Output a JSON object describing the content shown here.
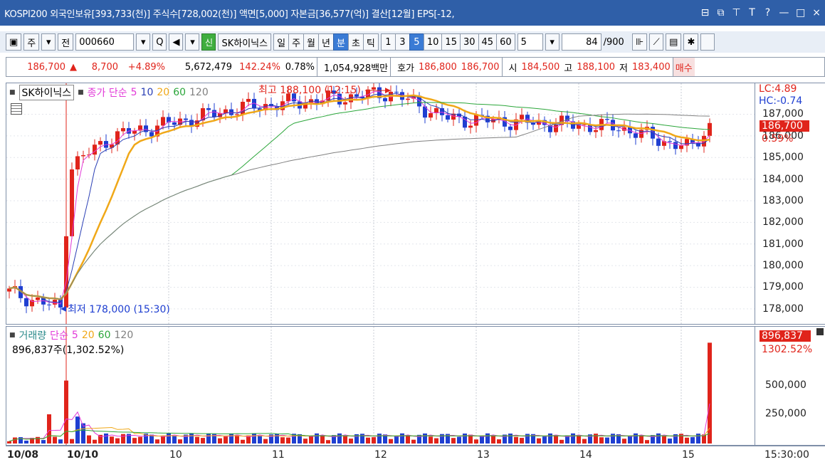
{
  "title": {
    "text": "KOSPI200 외국인보유[393,733(천)] 주식수[728,002(천)] 액면[5,000] 자본금[36,577(억)] 결산[12월] EPS[-12,",
    "icons": [
      "window-restore-icon",
      "popout-icon",
      "pin-icon",
      "font-icon",
      "help-icon",
      "minimize-icon",
      "maximize-icon",
      "close-icon"
    ],
    "icon_glyphs": [
      "⊟",
      "⧉",
      "⊤",
      "T",
      "?",
      "—",
      "□",
      "×"
    ]
  },
  "toolbar": {
    "menu_label": "주",
    "market_label": "전",
    "code": "000660",
    "search_glyph": "Q",
    "sound_glyph": "◀",
    "new_label": "신",
    "stock_name": "SK하이닉스",
    "period_buttons": [
      "일",
      "주",
      "월",
      "년"
    ],
    "active_period": "분",
    "sub_buttons": [
      "분",
      "초",
      "틱"
    ],
    "interval_buttons": [
      "1",
      "3",
      "5",
      "10",
      "15",
      "30",
      "45",
      "60"
    ],
    "active_interval": "5",
    "interval_value": "5",
    "count_value": "84",
    "count_total": "/900"
  },
  "quote": {
    "price": "186,700",
    "arrow": "▲",
    "change": "8,700",
    "change_pct": "+4.89%",
    "volume": "5,672,479",
    "vol_ratio": "142.24%",
    "turnover": "0.78%",
    "amount": "1,054,928백만",
    "bid_label": "호가",
    "ask_price": "186,800",
    "bid_price": "186,700",
    "open_label": "시",
    "open": "184,500",
    "high_label": "고",
    "high": "188,100",
    "low_label": "저",
    "low": "183,400",
    "buy_button": "매수"
  },
  "price_legend": {
    "name": "SK하이닉스",
    "ma_type": "종가 단순",
    "periods": [
      "5",
      "10",
      "20",
      "60",
      "120"
    ],
    "max_annotation": "최고 188,100 (12:15)",
    "min_annotation": "최저 178,000 (15:30)"
  },
  "volume_legend": {
    "name": "거래량",
    "ma_type": "단순",
    "periods": [
      "5",
      "20",
      "60",
      "120"
    ],
    "current": "896,837주(1,302.52%)"
  },
  "price_axis": {
    "lc": "LC:4.89",
    "hc": "HC:-0.74",
    "current_price": "186,700",
    "current_pct": "0.59%",
    "ticks": [
      "187,000",
      "186,000",
      "185,000",
      "184,000",
      "183,000",
      "182,000",
      "181,000",
      "180,000",
      "179,000",
      "178,000"
    ]
  },
  "volume_axis": {
    "current_volume": "896,837",
    "current_pct": "1302.52%",
    "ticks": [
      "500,000",
      "250,000"
    ]
  },
  "time_axis": {
    "labels": [
      "10/08",
      "10/10",
      "10",
      "11",
      "12",
      "13",
      "14",
      "15"
    ],
    "current_time": "15:30:00"
  },
  "colors": {
    "up": "#e0241b",
    "down": "#1f3fd1",
    "ma5": "#e23ad8",
    "ma10": "#2a3fb5",
    "ma20": "#f0a818",
    "ma60": "#2ba63a",
    "ma120": "#808080"
  },
  "chart_data": [
    {
      "type": "candlestick",
      "title": "SK하이닉스",
      "ylim": [
        177500,
        188300
      ],
      "x": [
        "10/08 15:20",
        "10/08 15:25",
        "10/08 15:30",
        "10/10 09:00",
        "10/10 10:00",
        "10/10 11:00",
        "10/10 12:15",
        "10/10 13:00",
        "10/10 14:00",
        "10/10 15:00",
        "10/10 15:30"
      ],
      "close": [
        178800,
        178400,
        178000,
        184600,
        186000,
        187300,
        188000,
        186800,
        186400,
        185400,
        186700
      ],
      "highlights": {
        "high": 188100,
        "high_time": "12:15",
        "low": 178000,
        "low_time": "15:30"
      }
    },
    {
      "type": "bar",
      "title": "거래량",
      "ylim": [
        0,
        950000
      ],
      "x": [
        "10/08",
        "10/10 09:00",
        "10/10 09:05",
        "10/10 09:10",
        "10/10 15:30"
      ],
      "values": [
        260000,
        560000,
        240000,
        180000,
        896837
      ]
    }
  ]
}
